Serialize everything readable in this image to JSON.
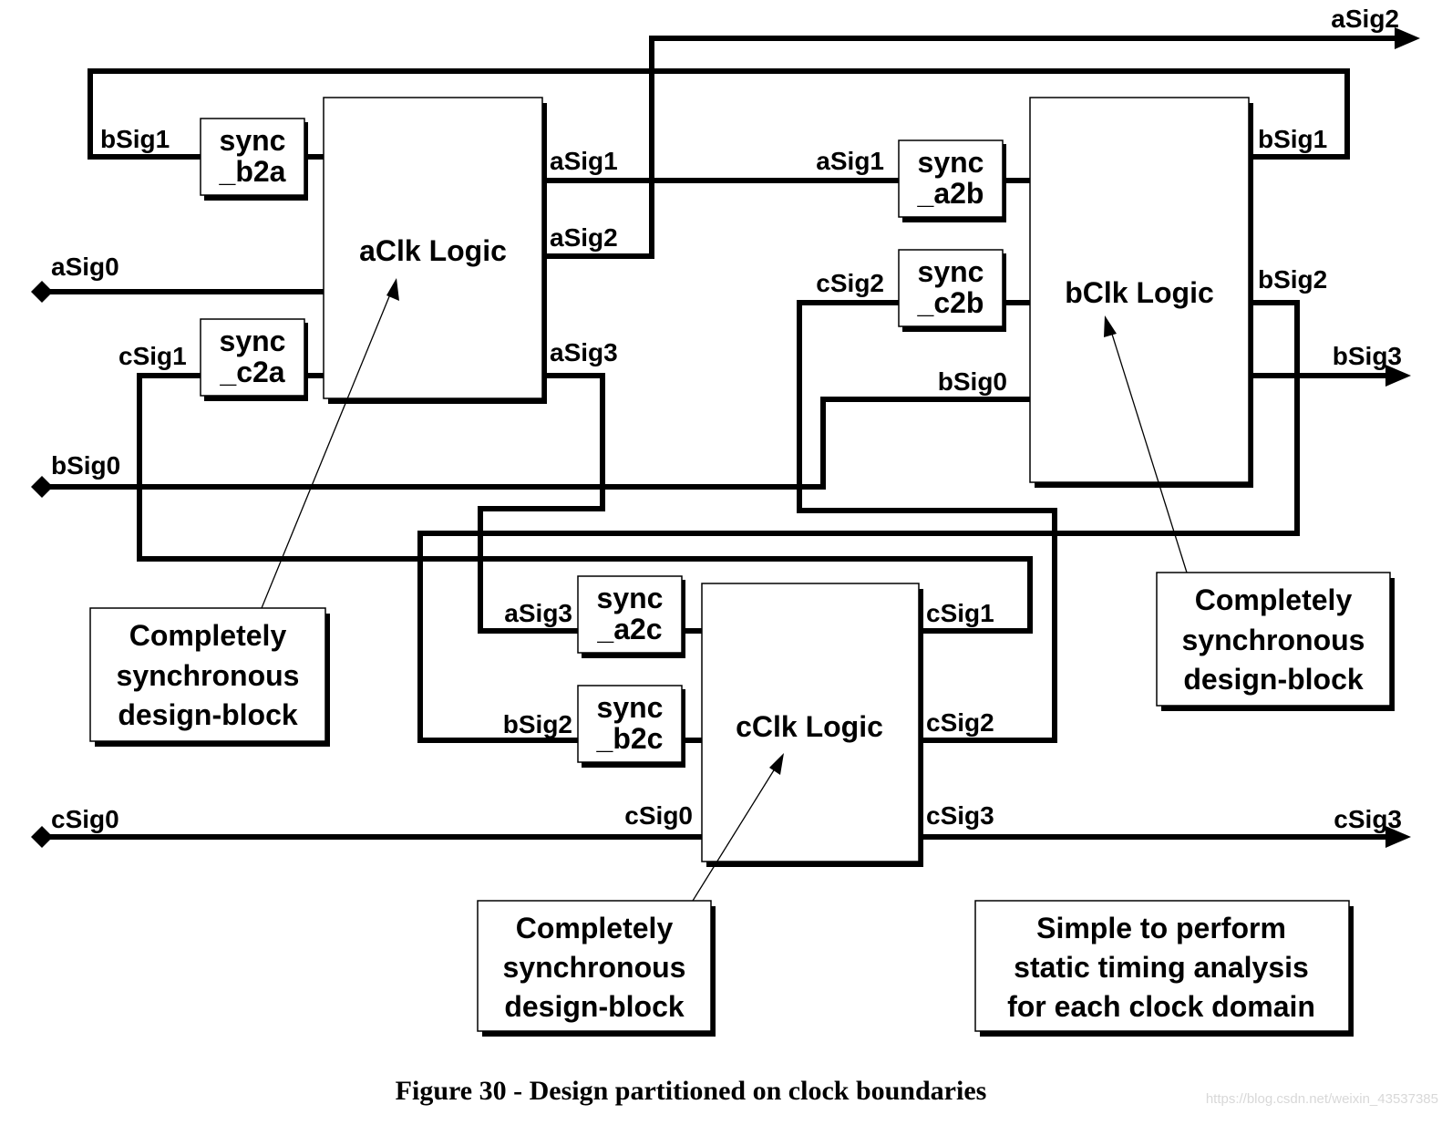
{
  "figure": {
    "caption": "Figure 30 - Design partitioned on clock boundaries",
    "watermark": "https://blog.csdn.net/weixin_43537385"
  },
  "logic_blocks": {
    "a": {
      "label": "aClk Logic"
    },
    "b": {
      "label": "bClk Logic"
    },
    "c": {
      "label": "cClk Logic"
    }
  },
  "sync_blocks": {
    "b2a": {
      "line1": "sync",
      "line2": "_b2a"
    },
    "c2a": {
      "line1": "sync",
      "line2": "_c2a"
    },
    "a2b": {
      "line1": "sync",
      "line2": "_a2b"
    },
    "c2b": {
      "line1": "sync",
      "line2": "_c2b"
    },
    "a2c": {
      "line1": "sync",
      "line2": "_a2c"
    },
    "b2c": {
      "line1": "sync",
      "line2": "_b2c"
    }
  },
  "signals": {
    "a_in_bsig1": "bSig1",
    "a_in_csig1": "cSig1",
    "a_in_asig0": "aSig0",
    "a_in_bsig0": "bSig0",
    "a_out_asig1": "aSig1",
    "a_out_asig2": "aSig2",
    "a_out_asig3": "aSig3",
    "top_out_asig2": "aSig2",
    "b_in_asig1": "aSig1",
    "b_in_csig2": "cSig2",
    "b_in_bsig0": "bSig0",
    "b_out_bsig1": "bSig1",
    "b_out_bsig2": "bSig2",
    "b_out_bsig3": "bSig3",
    "c_in_asig3": "aSig3",
    "c_in_bsig2": "bSig2",
    "c_in_csig0": "cSig0",
    "c_out_csig1": "cSig1",
    "c_out_csig2": "cSig2",
    "c_out_csig3": "cSig3",
    "port_csig0": "cSig0",
    "port_csig3": "cSig3"
  },
  "notes": {
    "a": [
      "Completely",
      "synchronous",
      "design-block"
    ],
    "b": [
      "Completely",
      "synchronous",
      "design-block"
    ],
    "c": [
      "Completely",
      "synchronous",
      "design-block"
    ],
    "sta": [
      "Simple to perform",
      "static timing analysis",
      "for each clock domain"
    ]
  }
}
